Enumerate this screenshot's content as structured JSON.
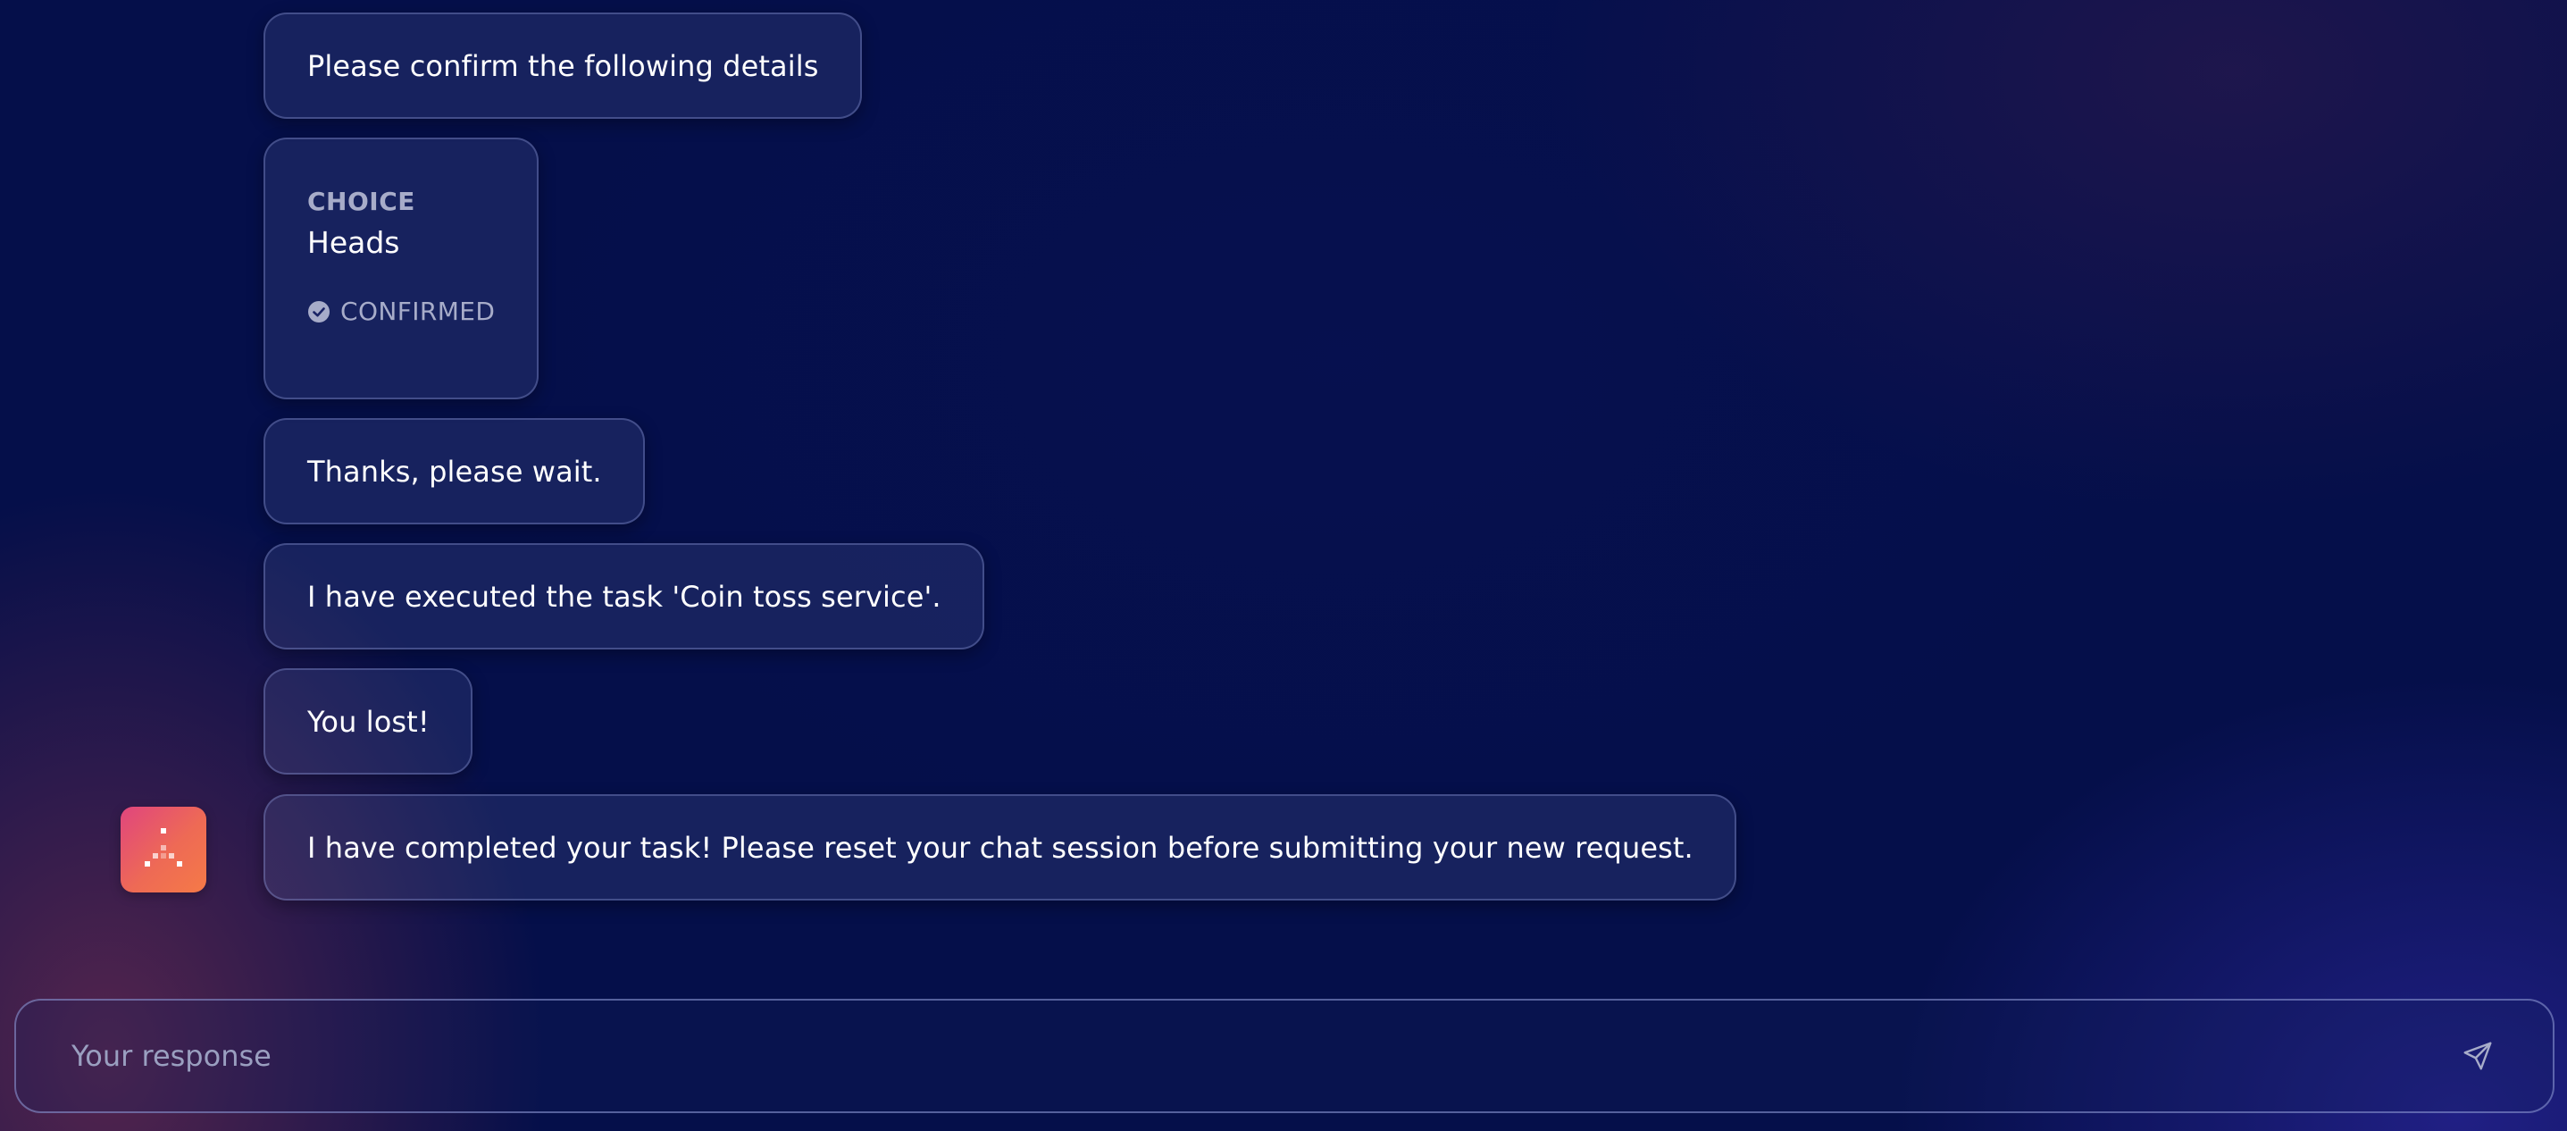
{
  "messages": [
    {
      "text": "Please confirm the following details"
    },
    {
      "text": "Thanks, please wait."
    },
    {
      "text": "I have executed the task 'Coin toss service'."
    },
    {
      "text": "You lost!"
    },
    {
      "text": "I have completed your task! Please reset your chat session before submitting your new request."
    }
  ],
  "confirm_card": {
    "label": "CHOICE",
    "value": "Heads",
    "status": "CONFIRMED",
    "status_icon": "check-circle-icon"
  },
  "assistant_avatar": {
    "icon": "assistant-logo-icon",
    "gradient": [
      "#e0457e",
      "#f57a47"
    ]
  },
  "composer": {
    "placeholder": "Your response",
    "value": "",
    "send_icon": "send-icon"
  },
  "colors": {
    "background": "#050f4a",
    "bubble_border": "#8c96d2",
    "muted_text": "#a7acc9",
    "placeholder": "#9a9fc0"
  }
}
